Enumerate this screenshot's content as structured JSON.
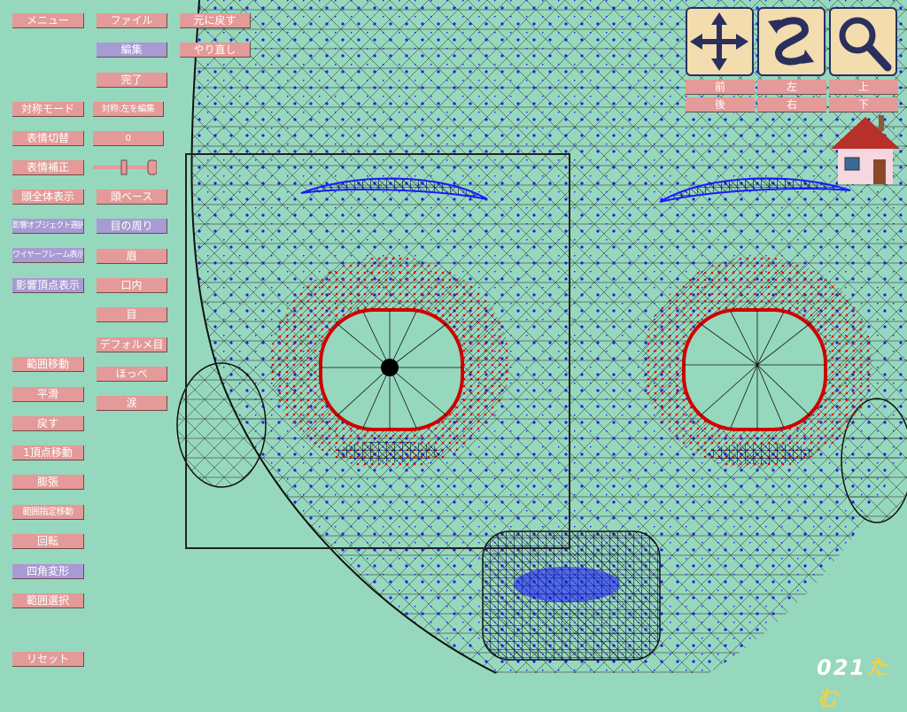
{
  "left_menu": {
    "menu": "メニュー",
    "symmetry_mode": "対称モード",
    "expression_switch": "表情切替",
    "expression_adjust": "表情補正",
    "whole_head": "頭全体表示",
    "influence_select": "影響オブジェクト選択",
    "wireframe": "ワイヤーフレーム表示",
    "influence_vertices": "影響頂点表示",
    "range_move": "範囲移動",
    "smooth": "平滑",
    "revert": "戻す",
    "one_vertex_move": "1頂点移動",
    "expand": "膨張",
    "range_specified_move": "範囲指定移動",
    "rotate": "回転",
    "quad_deform": "四角変形",
    "range_select": "範囲選択",
    "reset": "リセット"
  },
  "middle_menu": {
    "file": "ファイル",
    "edit": "編集",
    "done": "完了",
    "symmetry_value": "対称:左を編集",
    "expression_value": "0",
    "head_base": "頭ベース",
    "around_eyes": "目の周り",
    "eyebrow": "眉",
    "mouth_inner": "口内",
    "eye": "目",
    "deformed_eye": "デフォルメ目",
    "cheek": "ほっぺ",
    "tears": "涙"
  },
  "top_menu": {
    "undo": "元に戻す",
    "redo": "やり直し"
  },
  "view_controls": {
    "front": "前",
    "back": "後",
    "left": "左",
    "right": "右",
    "up": "上",
    "down": "下"
  },
  "logo": {
    "part1": "021",
    "part2": "たむ"
  }
}
